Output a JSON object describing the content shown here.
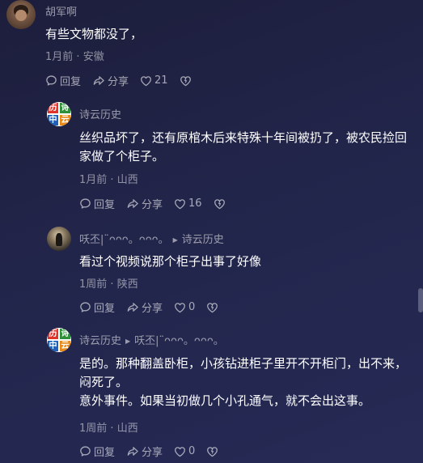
{
  "comments": [
    {
      "username": "胡军啊",
      "text": "有些文物都没了，",
      "time": "1月前",
      "location": "安徽",
      "reply_label": "回复",
      "share_label": "分享",
      "like_count": "21"
    },
    {
      "username": "诗云历史",
      "text": "丝织品坏了，还有原棺木后来特殊十年间被扔了，被农民捡回家做了个柜子。",
      "time": "1月前",
      "location": "山西",
      "reply_label": "回复",
      "share_label": "分享",
      "like_count": "16"
    },
    {
      "username": "㕭丕|¨ᴖᴖᴖ。ᴖᴖᴖ。",
      "reply_to": "诗云历史",
      "text": "看过个视频说那个柜子出事了好像",
      "time": "1周前",
      "location": "陕西",
      "reply_label": "回复",
      "share_label": "分享",
      "like_count": "0"
    },
    {
      "username": "诗云历史",
      "reply_to": "㕭丕|¨ᴖᴖᴖ。ᴖᴖᴖ。",
      "text_line1": "是的。那种翻盖卧柜，小孩钻进柜子里开不开柜门，出不来，闷死了。",
      "text_line2": "意外事件。如果当初做几个小孔通气，就不会出这事。",
      "time": "1周前",
      "location": "山西",
      "reply_label": "回复",
      "share_label": "分享",
      "like_count": "0"
    }
  ],
  "avatar_text": {
    "tl": "历",
    "tr": "诗",
    "bl": "中",
    "br": "云"
  },
  "separator": "·",
  "colors": {
    "background_top": "#1d1e3c",
    "background_bottom": "#262a55",
    "text_primary": "#ffffff",
    "avatar_red": "#e0342b",
    "avatar_green": "#2f8f3a",
    "avatar_blue": "#1f5fb8",
    "avatar_orange": "#e88a1a"
  }
}
